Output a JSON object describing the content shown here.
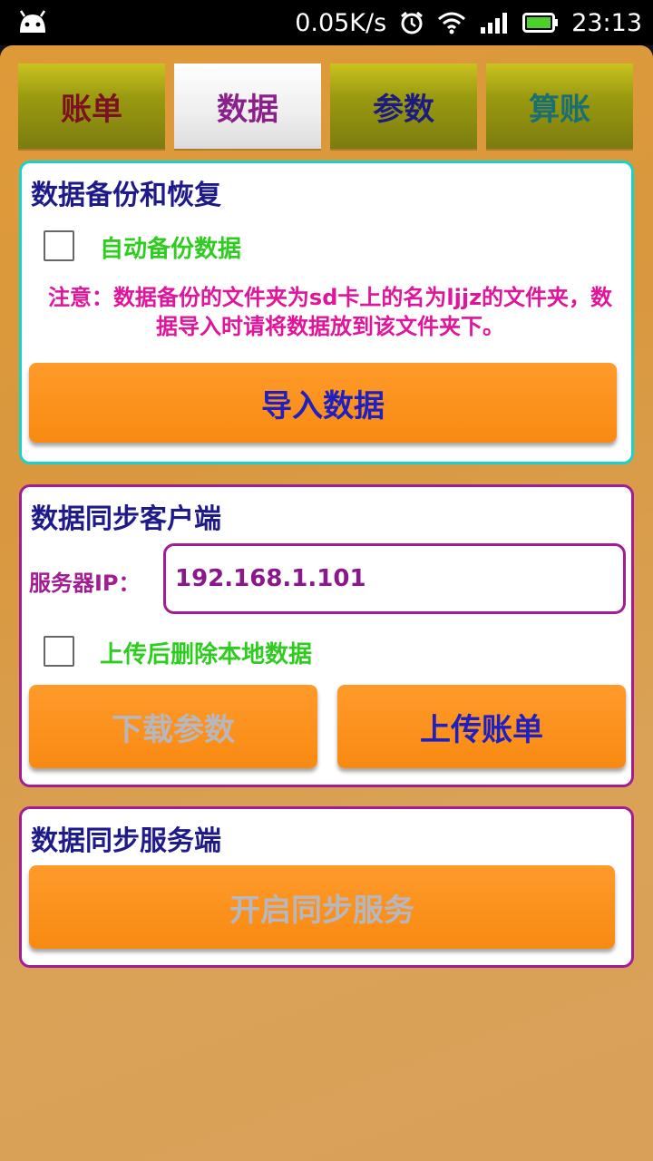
{
  "statusbar": {
    "speed": "0.05K/s",
    "time": "23:13"
  },
  "tabs": [
    {
      "label": "账单",
      "color": "#7a1220"
    },
    {
      "label": "数据",
      "color": "#8b208b",
      "active": true
    },
    {
      "label": "参数",
      "color": "#1c1c80"
    },
    {
      "label": "算账",
      "color": "#1a7070"
    }
  ],
  "backup": {
    "title": "数据备份和恢复",
    "auto_backup_label": "自动备份数据",
    "note": "注意：数据备份的文件夹为sd卡上的名为ljjz的文件夹，数据导入时请将数据放到该文件夹下。",
    "import_button": "导入数据"
  },
  "client": {
    "title": "数据同步客户端",
    "server_ip_label": "服务器IP：",
    "server_ip_value": "192.168.1.101",
    "delete_after_upload_label": "上传后删除本地数据",
    "download_button": "下载参数",
    "upload_button": "上传账单"
  },
  "server": {
    "title": "数据同步服务端",
    "start_button": "开启同步服务"
  }
}
